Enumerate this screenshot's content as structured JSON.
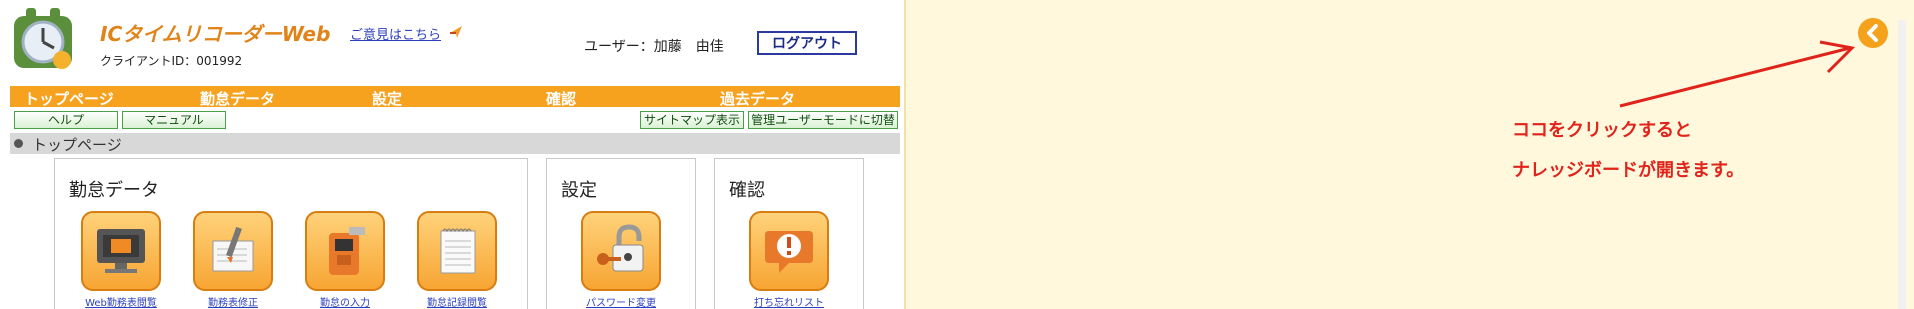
{
  "header": {
    "app_title": "ICタイムリコーダーWeb",
    "client_id": "クライアントID：001992",
    "feedback_link": "ご意見はこちら",
    "user_label": "ユーザー：加藤　由佳",
    "logout_label": "ログアウト"
  },
  "nav": {
    "items": [
      "トップページ",
      "勤怠データ",
      "設定",
      "確認",
      "過去データ"
    ]
  },
  "subnav": {
    "help": "ヘルプ",
    "manual": "マニュアル",
    "sitemap": "サイトマップ表示",
    "admin_mode": "管理ユーザーモードに切替"
  },
  "breadcrumb": {
    "label": "トップページ"
  },
  "panels": {
    "attendance": {
      "title": "勤怠データ",
      "tiles": [
        "Web勤務表閲覧",
        "勤務表修正",
        "勤怠の入力",
        "勤怠記録閲覧"
      ]
    },
    "settings": {
      "title": "設定",
      "tiles": [
        "パスワード変更"
      ]
    },
    "confirm": {
      "title": "確認",
      "tiles": [
        "打ち忘れリスト"
      ]
    }
  },
  "annotation": {
    "line1": "ココをクリックすると",
    "line2": "ナレッジボードが開きます。"
  },
  "colors": {
    "nav_orange": "#f6a21f",
    "title_orange": "#e0841a",
    "note_red": "#e0231b",
    "page_bg": "#fff8dc"
  }
}
